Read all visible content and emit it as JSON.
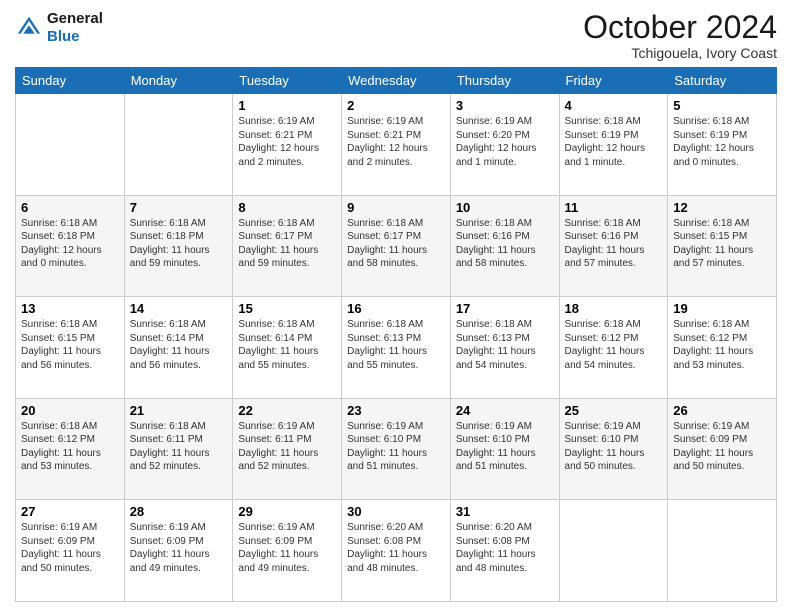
{
  "logo": {
    "line1": "General",
    "line2": "Blue"
  },
  "title": "October 2024",
  "subtitle": "Tchigouela, Ivory Coast",
  "days": [
    "Sunday",
    "Monday",
    "Tuesday",
    "Wednesday",
    "Thursday",
    "Friday",
    "Saturday"
  ],
  "weeks": [
    [
      {
        "day": "",
        "text": ""
      },
      {
        "day": "",
        "text": ""
      },
      {
        "day": "1",
        "text": "Sunrise: 6:19 AM\nSunset: 6:21 PM\nDaylight: 12 hours\nand 2 minutes."
      },
      {
        "day": "2",
        "text": "Sunrise: 6:19 AM\nSunset: 6:21 PM\nDaylight: 12 hours\nand 2 minutes."
      },
      {
        "day": "3",
        "text": "Sunrise: 6:19 AM\nSunset: 6:20 PM\nDaylight: 12 hours\nand 1 minute."
      },
      {
        "day": "4",
        "text": "Sunrise: 6:18 AM\nSunset: 6:19 PM\nDaylight: 12 hours\nand 1 minute."
      },
      {
        "day": "5",
        "text": "Sunrise: 6:18 AM\nSunset: 6:19 PM\nDaylight: 12 hours\nand 0 minutes."
      }
    ],
    [
      {
        "day": "6",
        "text": "Sunrise: 6:18 AM\nSunset: 6:18 PM\nDaylight: 12 hours\nand 0 minutes."
      },
      {
        "day": "7",
        "text": "Sunrise: 6:18 AM\nSunset: 6:18 PM\nDaylight: 11 hours\nand 59 minutes."
      },
      {
        "day": "8",
        "text": "Sunrise: 6:18 AM\nSunset: 6:17 PM\nDaylight: 11 hours\nand 59 minutes."
      },
      {
        "day": "9",
        "text": "Sunrise: 6:18 AM\nSunset: 6:17 PM\nDaylight: 11 hours\nand 58 minutes."
      },
      {
        "day": "10",
        "text": "Sunrise: 6:18 AM\nSunset: 6:16 PM\nDaylight: 11 hours\nand 58 minutes."
      },
      {
        "day": "11",
        "text": "Sunrise: 6:18 AM\nSunset: 6:16 PM\nDaylight: 11 hours\nand 57 minutes."
      },
      {
        "day": "12",
        "text": "Sunrise: 6:18 AM\nSunset: 6:15 PM\nDaylight: 11 hours\nand 57 minutes."
      }
    ],
    [
      {
        "day": "13",
        "text": "Sunrise: 6:18 AM\nSunset: 6:15 PM\nDaylight: 11 hours\nand 56 minutes."
      },
      {
        "day": "14",
        "text": "Sunrise: 6:18 AM\nSunset: 6:14 PM\nDaylight: 11 hours\nand 56 minutes."
      },
      {
        "day": "15",
        "text": "Sunrise: 6:18 AM\nSunset: 6:14 PM\nDaylight: 11 hours\nand 55 minutes."
      },
      {
        "day": "16",
        "text": "Sunrise: 6:18 AM\nSunset: 6:13 PM\nDaylight: 11 hours\nand 55 minutes."
      },
      {
        "day": "17",
        "text": "Sunrise: 6:18 AM\nSunset: 6:13 PM\nDaylight: 11 hours\nand 54 minutes."
      },
      {
        "day": "18",
        "text": "Sunrise: 6:18 AM\nSunset: 6:12 PM\nDaylight: 11 hours\nand 54 minutes."
      },
      {
        "day": "19",
        "text": "Sunrise: 6:18 AM\nSunset: 6:12 PM\nDaylight: 11 hours\nand 53 minutes."
      }
    ],
    [
      {
        "day": "20",
        "text": "Sunrise: 6:18 AM\nSunset: 6:12 PM\nDaylight: 11 hours\nand 53 minutes."
      },
      {
        "day": "21",
        "text": "Sunrise: 6:18 AM\nSunset: 6:11 PM\nDaylight: 11 hours\nand 52 minutes."
      },
      {
        "day": "22",
        "text": "Sunrise: 6:19 AM\nSunset: 6:11 PM\nDaylight: 11 hours\nand 52 minutes."
      },
      {
        "day": "23",
        "text": "Sunrise: 6:19 AM\nSunset: 6:10 PM\nDaylight: 11 hours\nand 51 minutes."
      },
      {
        "day": "24",
        "text": "Sunrise: 6:19 AM\nSunset: 6:10 PM\nDaylight: 11 hours\nand 51 minutes."
      },
      {
        "day": "25",
        "text": "Sunrise: 6:19 AM\nSunset: 6:10 PM\nDaylight: 11 hours\nand 50 minutes."
      },
      {
        "day": "26",
        "text": "Sunrise: 6:19 AM\nSunset: 6:09 PM\nDaylight: 11 hours\nand 50 minutes."
      }
    ],
    [
      {
        "day": "27",
        "text": "Sunrise: 6:19 AM\nSunset: 6:09 PM\nDaylight: 11 hours\nand 50 minutes."
      },
      {
        "day": "28",
        "text": "Sunrise: 6:19 AM\nSunset: 6:09 PM\nDaylight: 11 hours\nand 49 minutes."
      },
      {
        "day": "29",
        "text": "Sunrise: 6:19 AM\nSunset: 6:09 PM\nDaylight: 11 hours\nand 49 minutes."
      },
      {
        "day": "30",
        "text": "Sunrise: 6:20 AM\nSunset: 6:08 PM\nDaylight: 11 hours\nand 48 minutes."
      },
      {
        "day": "31",
        "text": "Sunrise: 6:20 AM\nSunset: 6:08 PM\nDaylight: 11 hours\nand 48 minutes."
      },
      {
        "day": "",
        "text": ""
      },
      {
        "day": "",
        "text": ""
      }
    ]
  ]
}
